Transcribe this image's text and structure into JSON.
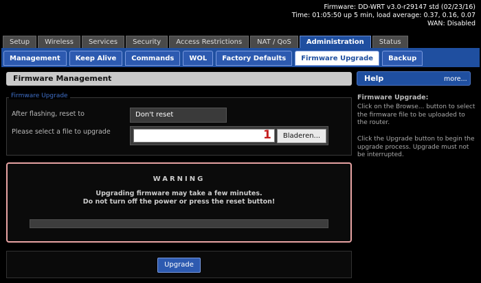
{
  "header": {
    "firmware": "Firmware: DD-WRT v3.0-r29147 std (02/23/16)",
    "time": "Time: 01:05:50 up 5 min, load average: 0.37, 0.16, 0.07",
    "wan": "WAN: Disabled"
  },
  "main_tabs": [
    {
      "label": "Setup"
    },
    {
      "label": "Wireless"
    },
    {
      "label": "Services"
    },
    {
      "label": "Security"
    },
    {
      "label": "Access Restrictions"
    },
    {
      "label": "NAT / QoS"
    },
    {
      "label": "Administration"
    },
    {
      "label": "Status"
    }
  ],
  "sub_tabs": [
    {
      "label": "Management"
    },
    {
      "label": "Keep Alive"
    },
    {
      "label": "Commands"
    },
    {
      "label": "WOL"
    },
    {
      "label": "Factory Defaults"
    },
    {
      "label": "Firmware Upgrade"
    },
    {
      "label": "Backup"
    }
  ],
  "section": {
    "title": "Firmware Management"
  },
  "fieldset": {
    "legend": "Firmware Upgrade",
    "reset_label": "After flashing, reset to",
    "reset_value": "Don't reset",
    "file_label": "Please select a file to upgrade",
    "file_number": "1",
    "browse_label": "Bladeren..."
  },
  "warning": {
    "title": "WARNING",
    "line1": "Upgrading firmware may take a few minutes.",
    "line2": "Do not turn off the power or press the reset button!",
    "progress": 0
  },
  "actions": {
    "upgrade_label": "Upgrade"
  },
  "help": {
    "title": "Help",
    "more": "more...",
    "subtitle": "Firmware Upgrade:",
    "para1": "Click on the Browse... button to select the firmware file to be uploaded to the router.",
    "para2": "Click the Upgrade button to begin the upgrade process. Upgrade must not be interrupted."
  },
  "colors": {
    "accent": "#1f4fa0",
    "warning_border": "#e9a4a4",
    "file_number": "#c41e1e"
  }
}
